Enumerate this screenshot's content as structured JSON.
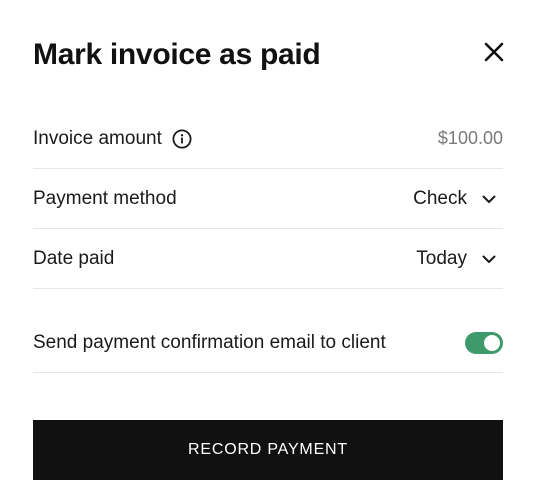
{
  "dialog": {
    "title": "Mark invoice as paid",
    "close_icon": "close-icon"
  },
  "rows": {
    "invoice_amount": {
      "label": "Invoice amount",
      "icon": "info-icon",
      "value": "$100.00"
    },
    "payment_method": {
      "label": "Payment method",
      "selected": "Check",
      "icon": "chevron-down-icon"
    },
    "date_paid": {
      "label": "Date paid",
      "selected": "Today",
      "icon": "chevron-down-icon"
    },
    "send_confirmation": {
      "label": "Send payment confirmation email to client",
      "enabled": true,
      "toggle_color": "#3f9a6b"
    }
  },
  "actions": {
    "record_label": "RECORD PAYMENT",
    "record_color": "#111111"
  }
}
